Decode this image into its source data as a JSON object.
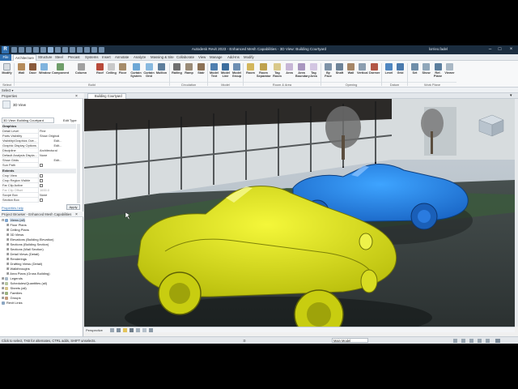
{
  "titlebar": {
    "title": "Autodesk Revit 2023 - Enhanced Mesh Capabilities - 3D View: Building Courtyard",
    "logo": "R",
    "user": "lorrieo.fadel",
    "min": "–",
    "max": "□",
    "close": "×"
  },
  "tabs": [
    "File",
    "Architecture",
    "Structure",
    "Steel",
    "Precast",
    "Systems",
    "Insert",
    "Annotate",
    "Analyze",
    "Massing & Site",
    "Collaborate",
    "View",
    "Manage",
    "Add-Ins",
    "Modify"
  ],
  "ribbon": {
    "buttons": [
      "Modify",
      "Wall",
      "Door",
      "Window",
      "Component",
      "Column",
      "Roof",
      "Ceiling",
      "Floor",
      "Curtain System",
      "Curtain Grid",
      "Mullion",
      "Railing",
      "Ramp",
      "Stair",
      "Model Text",
      "Model Line",
      "Model Group",
      "Room",
      "Room Separator",
      "Tag Room",
      "Area",
      "Area Boundary",
      "Tag Area",
      "By Face",
      "Shaft",
      "Wall",
      "Vertical",
      "Dormer",
      "Level",
      "Grid",
      "Set",
      "Show",
      "Ref. Plane",
      "Viewer"
    ],
    "groups": [
      "Select",
      "Build",
      "Circulation",
      "Model",
      "Room & Area",
      "Opening",
      "Datum",
      "Work Plane"
    ]
  },
  "optbar": {
    "select": "Select ▾"
  },
  "properties": {
    "header": "Properties",
    "type": "3D View",
    "instance": "3D View: Building Courtyard",
    "edit_type": "Edit Type",
    "cat_graphics": "Graphics",
    "cat_extents": "Extents",
    "rows": [
      {
        "k": "Detail Level",
        "v": "Fine"
      },
      {
        "k": "Parts Visibility",
        "v": "Show Original"
      },
      {
        "k": "Visibility/Graphics Ove...",
        "v": "Edit..."
      },
      {
        "k": "Graphic Display Options",
        "v": "Edit..."
      },
      {
        "k": "Discipline",
        "v": "Architectural"
      },
      {
        "k": "Default Analysis Displa...",
        "v": "None"
      },
      {
        "k": "Show Grids",
        "v": "Edit..."
      },
      {
        "k": "Sun Path",
        "v": ""
      }
    ],
    "rows2": [
      {
        "k": "Crop View",
        "v": ""
      },
      {
        "k": "Crop Region Visible",
        "v": ""
      },
      {
        "k": "Far Clip Active",
        "v": ""
      },
      {
        "k": "Far Clip Offset",
        "v": "1000.0"
      },
      {
        "k": "Scope Box",
        "v": "None"
      },
      {
        "k": "Section Box",
        "v": ""
      }
    ],
    "help": "Properties help",
    "apply": "Apply"
  },
  "browser": {
    "header": "Project Browser - Enhanced Mesh Capabilities",
    "items": [
      "Views (all)",
      "Floor Plans",
      "Ceiling Plans",
      "3D Views",
      "Elevations (Building Elevation)",
      "Sections (Building Section)",
      "Sections (Wall Section)",
      "Detail Views (Detail)",
      "Renderings",
      "Drafting Views (Detail)",
      "Walkthroughs",
      "Area Plans (Gross Building)",
      "Legends",
      "Schedules/Quantities (all)",
      "Sheets (all)",
      "Families",
      "Groups",
      "Revit Links"
    ]
  },
  "view": {
    "tab": "Building Courtyard",
    "scale": "Perspective"
  },
  "status": {
    "hint": "Click to select, TAB for alternates, CTRL adds, SHIFT unselects.",
    "coords": ":0",
    "model": "Main Model"
  },
  "colors": {
    "titlebar": "#1b2d3f",
    "accent": "#2f6fb0",
    "car_yellow": "#e9ee1b",
    "car_blue": "#2e8ef0"
  }
}
